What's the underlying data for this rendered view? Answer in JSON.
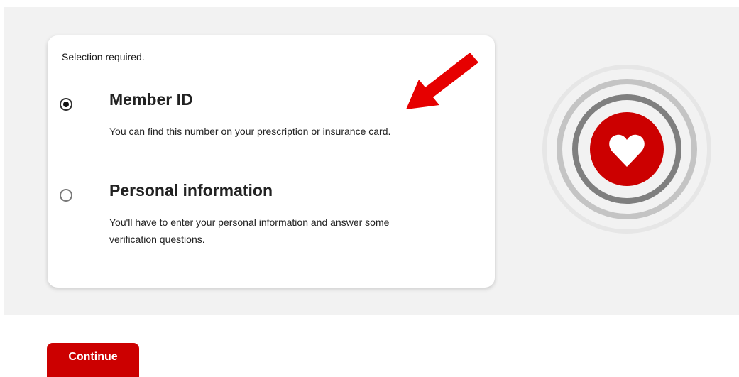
{
  "form": {
    "required_notice": "Selection required.",
    "options": [
      {
        "title": "Member ID",
        "description": "You can find this number on your prescription or insurance card.",
        "selected": true
      },
      {
        "title": "Personal information",
        "description": "You'll have to enter your personal information and answer some verification questions.",
        "selected": false
      }
    ]
  },
  "actions": {
    "continue_label": "Continue"
  },
  "colors": {
    "brand_red": "#cc0000",
    "panel_bg": "#f2f2f2",
    "annotation_arrow": "#e60000"
  },
  "icons": {
    "annotation": "red-arrow-icon",
    "illustration": "heart-target-icon"
  }
}
